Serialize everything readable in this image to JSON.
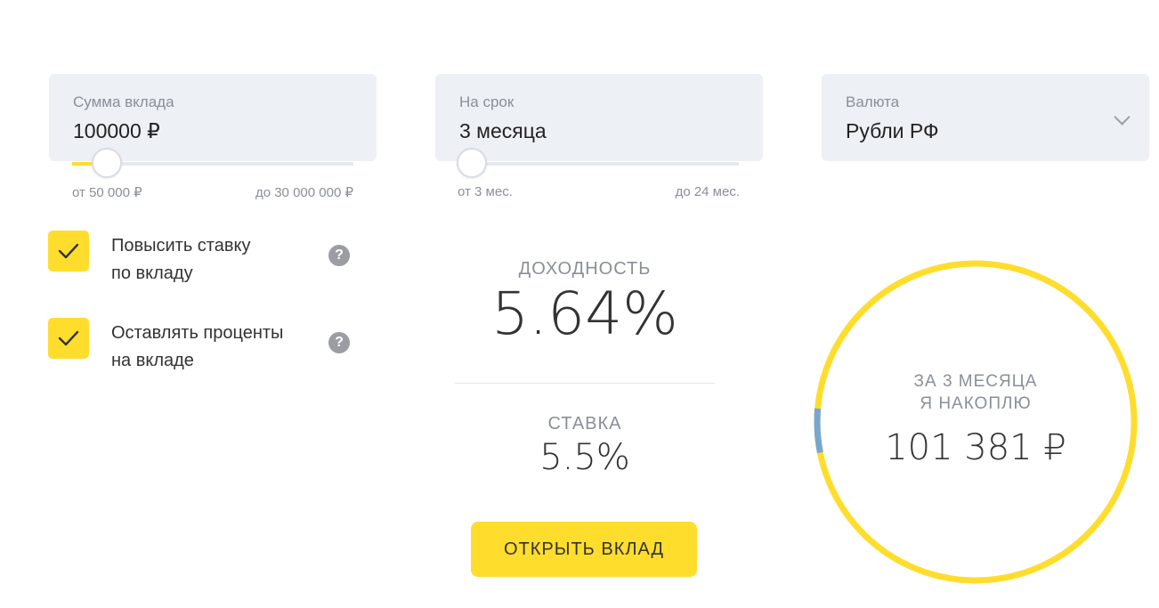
{
  "deposit_amount": {
    "label": "Сумма вклада",
    "value": "100000 ₽",
    "min_label": "от 50 000 ₽",
    "max_label": "до 30 000 000 ₽",
    "slider_fraction": 0.07
  },
  "term": {
    "label": "На срок",
    "value": "3 месяца",
    "min_label": "от 3 мес.",
    "max_label": "до 24 мес.",
    "slider_fraction": 0.0
  },
  "currency": {
    "label": "Валюта",
    "value": "Рубли РФ",
    "icon": "chevron-down-icon"
  },
  "options": [
    {
      "label_line1": "Повысить ставку",
      "label_line2": "по вкладу",
      "checked": true,
      "help": "?"
    },
    {
      "label_line1": "Оставлять проценты",
      "label_line2": "на вкладе",
      "checked": true,
      "help": "?"
    }
  ],
  "yield": {
    "caption": "ДОХОДНОСТЬ",
    "value": "5.64%"
  },
  "rate": {
    "caption": "СТАВКА",
    "value": "5.5%"
  },
  "open_button": {
    "label": "ОТКРЫТЬ ВКЛАД"
  },
  "summary": {
    "line1": "ЗА 3 МЕСЯЦА",
    "line2": "Я НАКОПЛЮ",
    "amount": "101 381 ₽",
    "income_fraction": 0.0136
  },
  "colors": {
    "accent": "#ffdd2d",
    "income": "#76a7d0",
    "field_bg": "#edf0f5",
    "muted_text": "#8a8f98"
  }
}
